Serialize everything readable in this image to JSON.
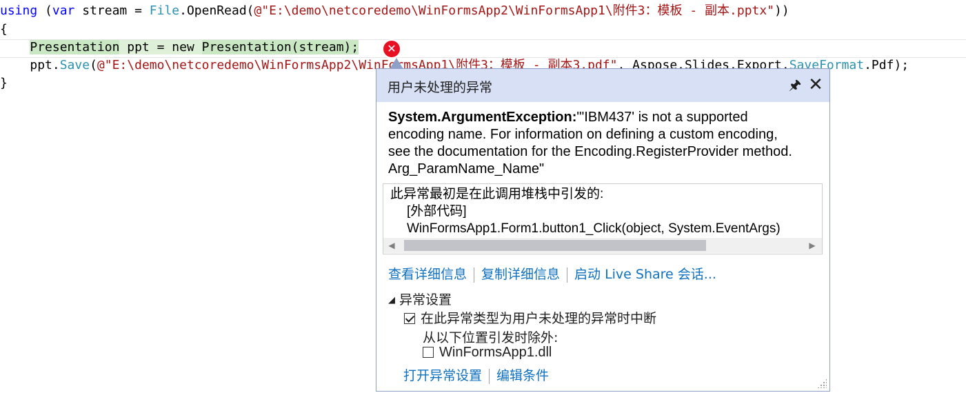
{
  "editor": {
    "line1": {
      "using_kw": "using",
      "open_paren": " (",
      "var_kw": "var",
      "assign": " stream = ",
      "file_type": "File",
      "open_read": ".OpenRead(",
      "path_str": "@\"E:\\demo\\netcoredemo\\WinFormsApp2\\WinFormsApp1\\附件3：模板 - 副本.pptx\"",
      "close": "))"
    },
    "line2": "{",
    "line3": {
      "indent": "    ",
      "type": "Presentation",
      "decl": " ppt = new ",
      "ctor": "Presentation(stream);"
    },
    "line4": {
      "indent": "    ",
      "obj": "ppt.",
      "method": "Save",
      "open": "(",
      "path_str": "@\"E:\\demo\\netcoredemo\\WinFormsApp2\\WinFormsApp1\\附件3：模板 - 副本3.pdf\"",
      "sep": ", Aspose.Slides.Export.",
      "enum_type": "SaveFormat",
      "tail": ".Pdf);"
    },
    "line5": "}",
    "error_glyph": "✕"
  },
  "exception_popup": {
    "title": "用户未处理的异常",
    "pin_icon": "🖈",
    "close_icon": "✕",
    "exception_type": "System.ArgumentException:",
    "exception_message": "\"'IBM437' is not a supported encoding name. For information on defining a custom encoding, see the documentation for the Encoding.RegisterProvider method. Arg_ParamName_Name\"",
    "stack": {
      "line1": "此异常最初是在此调用堆栈中引发的:",
      "line2": "[外部代码]",
      "line3": "WinFormsApp1.Form1.button1_Click(object, System.EventArgs)"
    },
    "links": {
      "view_details": "查看详细信息",
      "copy_details": "复制详细信息",
      "live_share": "启动 Live Share 会话..."
    },
    "settings": {
      "header": "异常设置",
      "break_when_unhandled": "在此异常类型为用户未处理的异常时中断",
      "break_checked": true,
      "except_from": "从以下位置引发时除外:",
      "module_name": "WinFormsApp1.dll",
      "module_checked": false,
      "open_settings": "打开异常设置",
      "edit_conditions": "编辑条件"
    }
  }
}
